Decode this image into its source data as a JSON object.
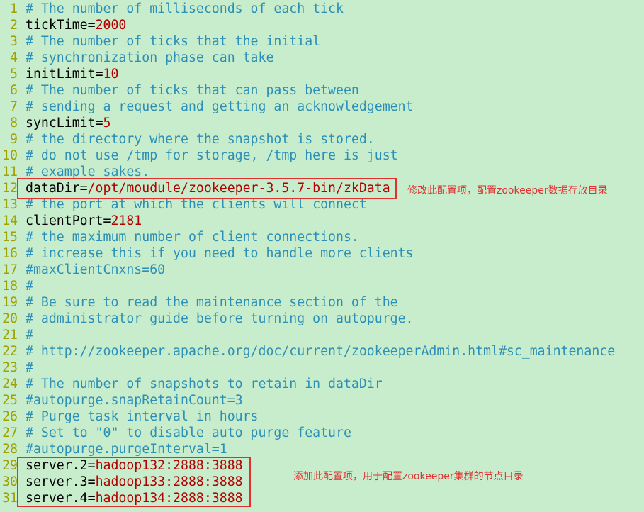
{
  "colors": {
    "background": "#c7edcc",
    "line_number": "#a0a000",
    "comment": "#2c8fb7",
    "value": "#b40000",
    "annotation": "#e03030"
  },
  "lines": [
    {
      "n": "1",
      "type": "comment",
      "text": "# The number of milliseconds of each tick"
    },
    {
      "n": "2",
      "type": "kv",
      "key": "tickTime",
      "value": "2000"
    },
    {
      "n": "3",
      "type": "comment",
      "text": "# The number of ticks that the initial"
    },
    {
      "n": "4",
      "type": "comment",
      "text": "# synchronization phase can take"
    },
    {
      "n": "5",
      "type": "kv",
      "key": "initLimit",
      "value": "10"
    },
    {
      "n": "6",
      "type": "comment",
      "text": "# The number of ticks that can pass between"
    },
    {
      "n": "7",
      "type": "comment",
      "text": "# sending a request and getting an acknowledgement"
    },
    {
      "n": "8",
      "type": "kv",
      "key": "syncLimit",
      "value": "5"
    },
    {
      "n": "9",
      "type": "comment",
      "text": "# the directory where the snapshot is stored."
    },
    {
      "n": "10",
      "type": "comment",
      "text": "# do not use /tmp for storage, /tmp here is just"
    },
    {
      "n": "11",
      "type": "comment",
      "text": "# example sakes."
    },
    {
      "n": "12",
      "type": "kv",
      "key": "dataDir",
      "value": "/opt/moudule/zookeeper-3.5.7-bin/zkData"
    },
    {
      "n": "13",
      "type": "comment",
      "text": "# the port at which the clients will connect"
    },
    {
      "n": "14",
      "type": "kv",
      "key": "clientPort",
      "value": "2181"
    },
    {
      "n": "15",
      "type": "comment",
      "text": "# the maximum number of client connections."
    },
    {
      "n": "16",
      "type": "comment",
      "text": "# increase this if you need to handle more clients"
    },
    {
      "n": "17",
      "type": "comment",
      "text": "#maxClientCnxns=60"
    },
    {
      "n": "18",
      "type": "comment",
      "text": "#"
    },
    {
      "n": "19",
      "type": "comment",
      "text": "# Be sure to read the maintenance section of the"
    },
    {
      "n": "20",
      "type": "comment",
      "text": "# administrator guide before turning on autopurge."
    },
    {
      "n": "21",
      "type": "comment",
      "text": "#"
    },
    {
      "n": "22",
      "type": "comment",
      "text": "# http://zookeeper.apache.org/doc/current/zookeeperAdmin.html#sc_maintenance"
    },
    {
      "n": "23",
      "type": "comment",
      "text": "#"
    },
    {
      "n": "24",
      "type": "comment",
      "text": "# The number of snapshots to retain in dataDir"
    },
    {
      "n": "25",
      "type": "comment",
      "text": "#autopurge.snapRetainCount=3"
    },
    {
      "n": "26",
      "type": "comment",
      "text": "# Purge task interval in hours"
    },
    {
      "n": "27",
      "type": "comment",
      "text": "# Set to \"0\" to disable auto purge feature"
    },
    {
      "n": "28",
      "type": "comment",
      "text": "#autopurge.purgeInterval=1"
    },
    {
      "n": "29",
      "type": "kv",
      "key": "server.2",
      "value": "hadoop132:2888:3888"
    },
    {
      "n": "30",
      "type": "kv",
      "key": "server.3",
      "value": "hadoop133:2888:3888"
    },
    {
      "n": "31",
      "type": "kv",
      "key": "server.4",
      "value": "hadoop134:2888:3888"
    }
  ],
  "annotations": {
    "datadir_note": "修改此配置项，配置zookeeper数据存放目录",
    "servers_note": "添加此配置项，用于配置zookeeper集群的节点目录"
  }
}
